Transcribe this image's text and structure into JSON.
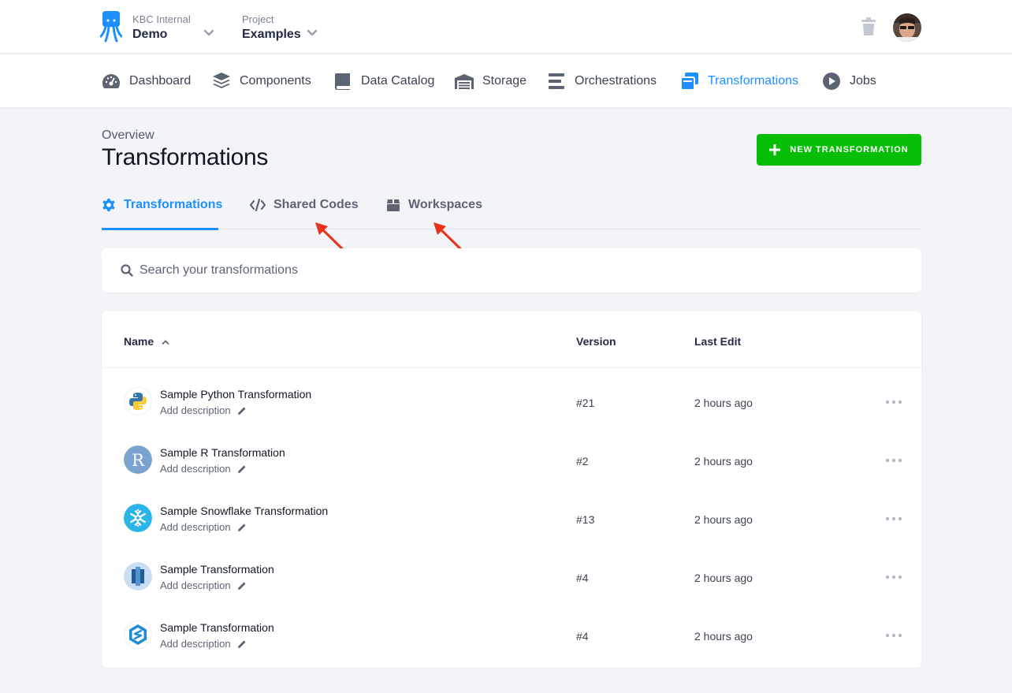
{
  "header": {
    "org": {
      "label": "KBC Internal",
      "value": "Demo"
    },
    "project": {
      "label": "Project",
      "value": "Examples"
    }
  },
  "nav": {
    "items": [
      {
        "label": "Dashboard",
        "icon": "dashboard-icon"
      },
      {
        "label": "Components",
        "icon": "layers-icon"
      },
      {
        "label": "Data Catalog",
        "icon": "book-icon"
      },
      {
        "label": "Storage",
        "icon": "warehouse-icon"
      },
      {
        "label": "Orchestrations",
        "icon": "bars-icon"
      },
      {
        "label": "Transformations",
        "icon": "transformations-icon",
        "active": true
      },
      {
        "label": "Jobs",
        "icon": "play-circle-icon"
      }
    ]
  },
  "page": {
    "overview": "Overview",
    "title": "Transformations",
    "new_button": "NEW TRANSFORMATION"
  },
  "tabs": [
    {
      "label": "Transformations",
      "icon": "gear-icon",
      "active": true
    },
    {
      "label": "Shared Codes",
      "icon": "code-icon"
    },
    {
      "label": "Workspaces",
      "icon": "box-icon"
    }
  ],
  "search": {
    "placeholder": "Search your transformations"
  },
  "table": {
    "columns": {
      "name": "Name",
      "version": "Version",
      "last_edit": "Last Edit"
    },
    "rows": [
      {
        "name": "Sample Python Transformation",
        "desc": "Add description",
        "version": "#21",
        "last_edit": "2 hours ago",
        "icon": "python-icon"
      },
      {
        "name": "Sample R Transformation",
        "desc": "Add description",
        "version": "#2",
        "last_edit": "2 hours ago",
        "icon": "r-icon"
      },
      {
        "name": "Sample Snowflake Transformation",
        "desc": "Add description",
        "version": "#13",
        "last_edit": "2 hours ago",
        "icon": "snowflake-icon"
      },
      {
        "name": "Sample Transformation",
        "desc": "Add description",
        "version": "#4",
        "last_edit": "2 hours ago",
        "icon": "redshift-icon"
      },
      {
        "name": "Sample Transformation",
        "desc": "Add description",
        "version": "#4",
        "last_edit": "2 hours ago",
        "icon": "synapse-icon"
      }
    ]
  },
  "colors": {
    "accent": "#1f8fff",
    "primary_button": "#07be07",
    "annotation_arrow": "#e8321c"
  }
}
